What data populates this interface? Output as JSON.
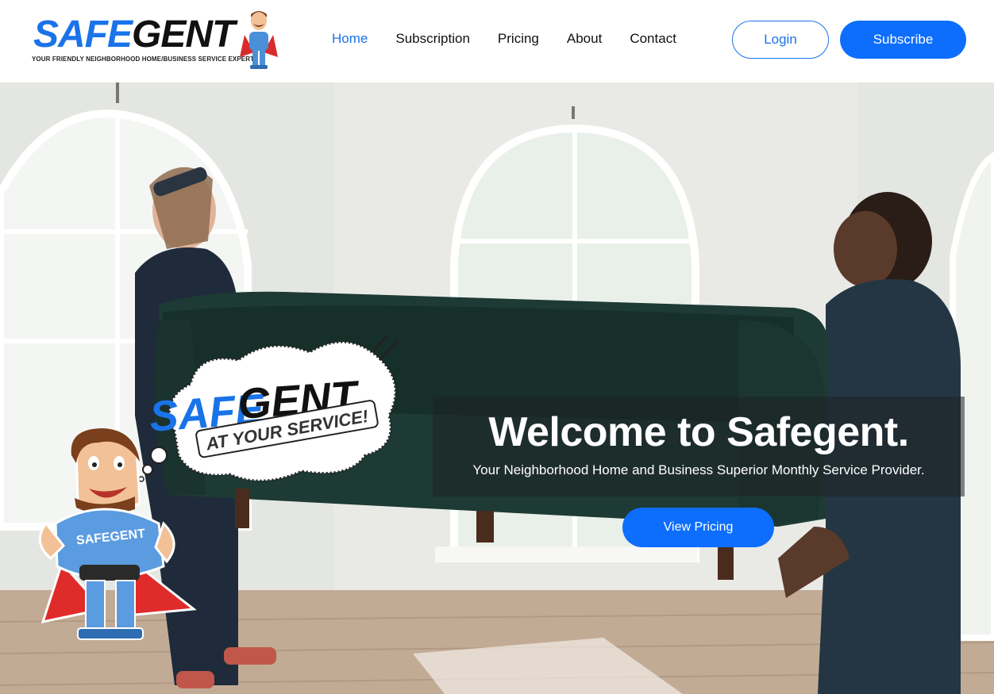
{
  "brand": {
    "logo_part1": "SAFE",
    "logo_part2": "GENT",
    "tagline": "YOUR FRIENDLY NEIGHBORHOOD HOME/BUSINESS SERVICE EXPERT",
    "primary_color": "#0d6efd",
    "mascot_shirt_text": "SAFEGENT"
  },
  "nav": {
    "items": [
      {
        "label": "Home",
        "active": true
      },
      {
        "label": "Subscription",
        "active": false
      },
      {
        "label": "Pricing",
        "active": false
      },
      {
        "label": "About",
        "active": false
      },
      {
        "label": "Contact",
        "active": false
      }
    ],
    "login_label": "Login",
    "subscribe_label": "Subscribe"
  },
  "hero": {
    "badge_part1": "SAFE",
    "badge_part2": "GENT",
    "badge_slogan": "AT YOUR SERVICE!",
    "title": "Welcome to Safegent.",
    "subtitle": "Your Neighborhood Home and Business Superior Monthly Service Provider.",
    "cta_label": "View Pricing"
  }
}
